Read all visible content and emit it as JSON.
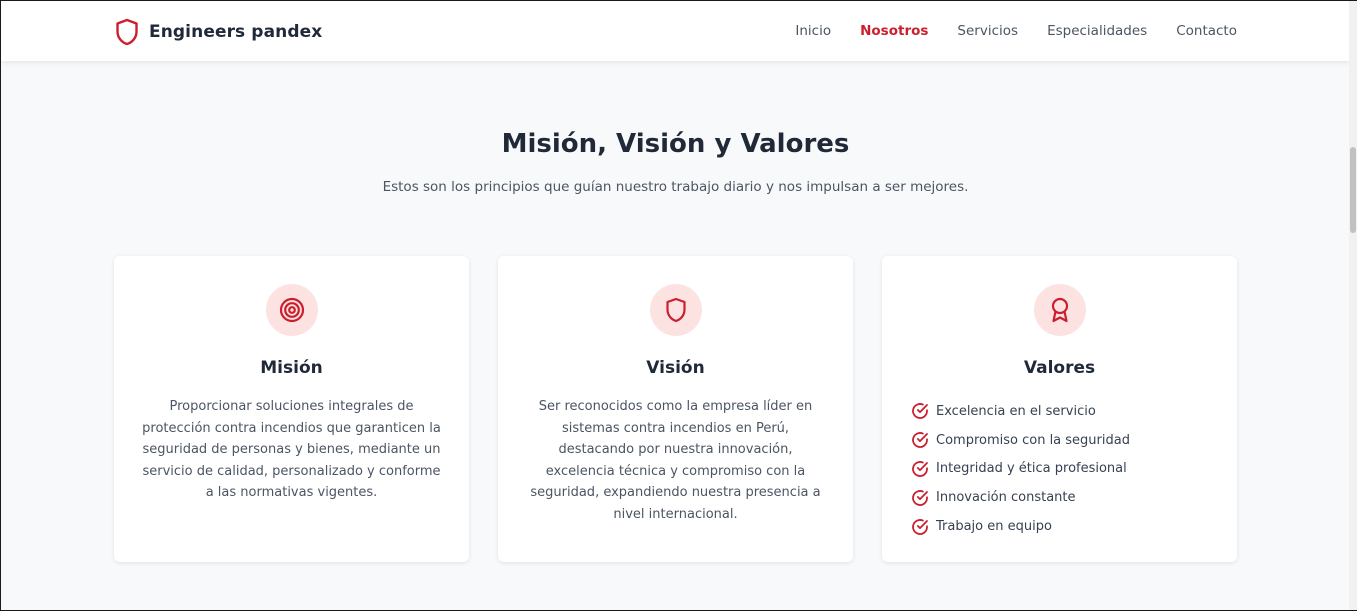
{
  "header": {
    "brand_name": "Engineers pandex",
    "nav": [
      {
        "label": "Inicio",
        "active": false
      },
      {
        "label": "Nosotros",
        "active": true
      },
      {
        "label": "Servicios",
        "active": false
      },
      {
        "label": "Especialidades",
        "active": false
      },
      {
        "label": "Contacto",
        "active": false
      }
    ]
  },
  "section": {
    "title": "Misión, Visión y Valores",
    "subtitle": "Estos son los principios que guían nuestro trabajo diario y nos impulsan a ser mejores."
  },
  "cards": [
    {
      "icon": "target-icon",
      "title": "Misión",
      "text": "Proporcionar soluciones integrales de protección contra incendios que garanticen la seguridad de personas y bienes, mediante un servicio de calidad, personalizado y conforme a las normativas vigentes."
    },
    {
      "icon": "shield-icon",
      "title": "Visión",
      "text": "Ser reconocidos como la empresa líder en sistemas contra incendios en Perú, destacando por nuestra innovación, excelencia técnica y compromiso con la seguridad, expandiendo nuestra presencia a nivel internacional."
    },
    {
      "icon": "award-icon",
      "title": "Valores",
      "items": [
        "Excelencia en el servicio",
        "Compromiso con la seguridad",
        "Integridad y ética profesional",
        "Innovación constante",
        "Trabajo en equipo"
      ]
    }
  ],
  "colors": {
    "accent": "#cc1f2d",
    "icon_bg": "#fde2e2",
    "heading": "#1f2937",
    "body_text": "#4b5563",
    "page_bg": "#f8f9fb"
  }
}
